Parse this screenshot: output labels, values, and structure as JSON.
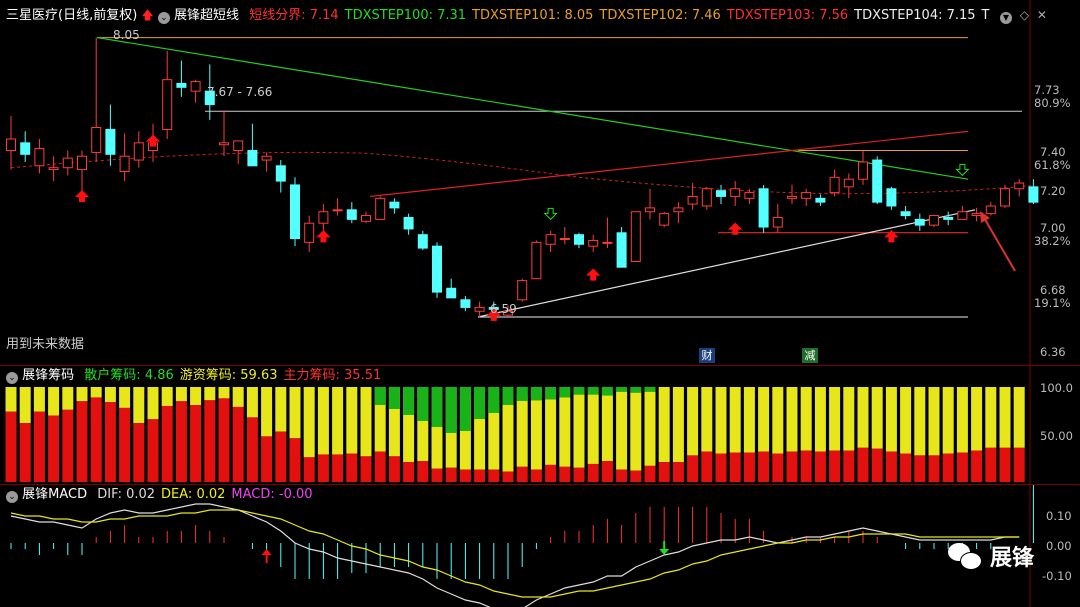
{
  "main_header": {
    "stock": "三星医疗(日线,前复权)",
    "indicator": "展锋超短线",
    "items": [
      {
        "label": "短线分界:",
        "value": "7.14",
        "color": "#ff3030"
      },
      {
        "label": "TDXSTEP100:",
        "value": "7.31",
        "color": "#22dd22"
      },
      {
        "label": "TDXSTEP101:",
        "value": "8.05",
        "color": "#e8a020"
      },
      {
        "label": "TDXSTEP102:",
        "value": "7.46",
        "color": "#e8a020"
      },
      {
        "label": "TDXSTEP103:",
        "value": "7.56",
        "color": "#ff3030"
      },
      {
        "label": "TDXSTEP104:",
        "value": "7.15",
        "color": "#eeeeee"
      },
      {
        "label": "T",
        "value": "",
        "color": "#eeeeee"
      }
    ],
    "icons": [
      "chevron-down-icon",
      "diamond-icon",
      "close-icon"
    ]
  },
  "annotations": {
    "high": "8.05",
    "range": "7.67 - 7.66",
    "low": "6.59",
    "future": "用到未来数据",
    "marker_cai": "财",
    "marker_jian": "减"
  },
  "main_axis": [
    "7.73",
    "80.9%",
    "7.40",
    "61.8%",
    "7.20",
    "7.00",
    "38.2%",
    "6.68",
    "19.1%",
    "6.36"
  ],
  "chips_header": {
    "name": "展锋筹码",
    "items": [
      {
        "label": "散户筹码:",
        "value": "4.86",
        "color": "#22dd22"
      },
      {
        "label": "游资筹码:",
        "value": "59.63",
        "color": "#eeee22"
      },
      {
        "label": "主力筹码:",
        "value": "35.51",
        "color": "#ff3030"
      }
    ]
  },
  "chips_axis": [
    "100.0",
    "50.00"
  ],
  "macd_header": {
    "name": "展锋MACD",
    "items": [
      {
        "label": "DIF:",
        "value": "0.02",
        "color": "#dddddd"
      },
      {
        "label": "DEA:",
        "value": "0.02",
        "color": "#eeee22"
      },
      {
        "label": "MACD:",
        "value": "-0.00",
        "color": "#ee44ee"
      }
    ]
  },
  "macd_axis": [
    "0.10",
    "0.00",
    "-0.10"
  ],
  "watermark": "展锋",
  "chart_data": {
    "type": "candlestick",
    "ylim": [
      6.36,
      8.1
    ],
    "candles": [
      {
        "o": 7.46,
        "h": 7.64,
        "l": 7.36,
        "c": 7.52
      },
      {
        "o": 7.5,
        "h": 7.56,
        "l": 7.4,
        "c": 7.44
      },
      {
        "o": 7.38,
        "h": 7.52,
        "l": 7.34,
        "c": 7.47
      },
      {
        "o": 7.36,
        "h": 7.43,
        "l": 7.3,
        "c": 7.37
      },
      {
        "o": 7.37,
        "h": 7.46,
        "l": 7.33,
        "c": 7.42
      },
      {
        "o": 7.36,
        "h": 7.46,
        "l": 7.22,
        "c": 7.43
      },
      {
        "o": 7.45,
        "h": 8.05,
        "l": 7.4,
        "c": 7.58
      },
      {
        "o": 7.57,
        "h": 7.7,
        "l": 7.38,
        "c": 7.44
      },
      {
        "o": 7.35,
        "h": 7.55,
        "l": 7.3,
        "c": 7.43
      },
      {
        "o": 7.41,
        "h": 7.56,
        "l": 7.37,
        "c": 7.5
      },
      {
        "o": 7.46,
        "h": 7.6,
        "l": 7.4,
        "c": 7.5
      },
      {
        "o": 7.57,
        "h": 7.98,
        "l": 7.52,
        "c": 7.83
      },
      {
        "o": 7.81,
        "h": 7.93,
        "l": 7.74,
        "c": 7.79
      },
      {
        "o": 7.77,
        "h": 7.83,
        "l": 7.71,
        "c": 7.82
      },
      {
        "o": 7.77,
        "h": 7.91,
        "l": 7.62,
        "c": 7.7
      },
      {
        "o": 7.49,
        "h": 7.67,
        "l": 7.43,
        "c": 7.5
      },
      {
        "o": 7.46,
        "h": 7.51,
        "l": 7.39,
        "c": 7.51
      },
      {
        "o": 7.46,
        "h": 7.6,
        "l": 7.38,
        "c": 7.38
      },
      {
        "o": 7.41,
        "h": 7.45,
        "l": 7.35,
        "c": 7.43
      },
      {
        "o": 7.38,
        "h": 7.41,
        "l": 7.24,
        "c": 7.3
      },
      {
        "o": 7.28,
        "h": 7.32,
        "l": 6.96,
        "c": 7.0
      },
      {
        "o": 6.98,
        "h": 7.12,
        "l": 6.93,
        "c": 7.08
      },
      {
        "o": 7.08,
        "h": 7.18,
        "l": 7.04,
        "c": 7.14
      },
      {
        "o": 7.15,
        "h": 7.21,
        "l": 7.12,
        "c": 7.15
      },
      {
        "o": 7.15,
        "h": 7.19,
        "l": 7.08,
        "c": 7.1
      },
      {
        "o": 7.09,
        "h": 7.14,
        "l": 7.08,
        "c": 7.12
      },
      {
        "o": 7.1,
        "h": 7.22,
        "l": 7.1,
        "c": 7.21
      },
      {
        "o": 7.19,
        "h": 7.21,
        "l": 7.13,
        "c": 7.16
      },
      {
        "o": 7.11,
        "h": 7.13,
        "l": 7.02,
        "c": 7.05
      },
      {
        "o": 7.02,
        "h": 7.04,
        "l": 6.94,
        "c": 6.95
      },
      {
        "o": 6.96,
        "h": 6.98,
        "l": 6.69,
        "c": 6.72
      },
      {
        "o": 6.74,
        "h": 6.79,
        "l": 6.7,
        "c": 6.69
      },
      {
        "o": 6.68,
        "h": 6.7,
        "l": 6.62,
        "c": 6.64
      },
      {
        "o": 6.62,
        "h": 6.67,
        "l": 6.59,
        "c": 6.64
      },
      {
        "o": 6.64,
        "h": 6.67,
        "l": 6.63,
        "c": 6.63
      },
      {
        "o": 6.6,
        "h": 6.65,
        "l": 6.59,
        "c": 6.62
      },
      {
        "o": 6.68,
        "h": 6.79,
        "l": 6.67,
        "c": 6.78
      },
      {
        "o": 6.79,
        "h": 6.99,
        "l": 6.79,
        "c": 6.98
      },
      {
        "o": 6.97,
        "h": 7.04,
        "l": 6.93,
        "c": 7.02
      },
      {
        "o": 7.0,
        "h": 7.06,
        "l": 6.97,
        "c": 7.0
      },
      {
        "o": 7.02,
        "h": 7.03,
        "l": 6.95,
        "c": 6.97
      },
      {
        "o": 6.96,
        "h": 7.02,
        "l": 6.93,
        "c": 6.99
      },
      {
        "o": 6.98,
        "h": 7.11,
        "l": 6.95,
        "c": 6.98
      },
      {
        "o": 7.03,
        "h": 7.06,
        "l": 6.85,
        "c": 6.85
      },
      {
        "o": 6.88,
        "h": 7.14,
        "l": 6.88,
        "c": 7.14
      },
      {
        "o": 7.14,
        "h": 7.26,
        "l": 7.1,
        "c": 7.16
      },
      {
        "o": 7.07,
        "h": 7.14,
        "l": 7.06,
        "c": 7.13
      },
      {
        "o": 7.14,
        "h": 7.19,
        "l": 7.08,
        "c": 7.16
      },
      {
        "o": 7.18,
        "h": 7.29,
        "l": 7.15,
        "c": 7.22
      },
      {
        "o": 7.17,
        "h": 7.27,
        "l": 7.15,
        "c": 7.26
      },
      {
        "o": 7.25,
        "h": 7.28,
        "l": 7.18,
        "c": 7.22
      },
      {
        "o": 7.22,
        "h": 7.3,
        "l": 7.17,
        "c": 7.26
      },
      {
        "o": 7.21,
        "h": 7.26,
        "l": 7.18,
        "c": 7.24
      },
      {
        "o": 7.26,
        "h": 7.28,
        "l": 7.03,
        "c": 7.06
      },
      {
        "o": 7.06,
        "h": 7.18,
        "l": 7.03,
        "c": 7.11
      },
      {
        "o": 7.21,
        "h": 7.28,
        "l": 7.18,
        "c": 7.22
      },
      {
        "o": 7.21,
        "h": 7.26,
        "l": 7.17,
        "c": 7.24
      },
      {
        "o": 7.21,
        "h": 7.23,
        "l": 7.17,
        "c": 7.19
      },
      {
        "o": 7.24,
        "h": 7.36,
        "l": 7.22,
        "c": 7.32
      },
      {
        "o": 7.27,
        "h": 7.34,
        "l": 7.21,
        "c": 7.31
      },
      {
        "o": 7.31,
        "h": 7.46,
        "l": 7.28,
        "c": 7.4
      },
      {
        "o": 7.41,
        "h": 7.43,
        "l": 7.18,
        "c": 7.19
      },
      {
        "o": 7.26,
        "h": 7.27,
        "l": 7.15,
        "c": 7.17
      },
      {
        "o": 7.14,
        "h": 7.17,
        "l": 7.1,
        "c": 7.12
      },
      {
        "o": 7.1,
        "h": 7.13,
        "l": 7.04,
        "c": 7.07
      },
      {
        "o": 7.07,
        "h": 7.12,
        "l": 7.06,
        "c": 7.12
      },
      {
        "o": 7.11,
        "h": 7.14,
        "l": 7.07,
        "c": 7.1
      },
      {
        "o": 7.1,
        "h": 7.17,
        "l": 7.1,
        "c": 7.14
      },
      {
        "o": 7.12,
        "h": 7.16,
        "l": 7.09,
        "c": 7.13
      },
      {
        "o": 7.13,
        "h": 7.19,
        "l": 7.12,
        "c": 7.17
      },
      {
        "o": 7.17,
        "h": 7.28,
        "l": 7.16,
        "c": 7.26
      },
      {
        "o": 7.26,
        "h": 7.31,
        "l": 7.22,
        "c": 7.29
      },
      {
        "o": 7.27,
        "h": 7.31,
        "l": 7.18,
        "c": 7.19
      }
    ],
    "chips": {
      "red": [
        74,
        62,
        74,
        70,
        76,
        85,
        89,
        84,
        78,
        62,
        66,
        80,
        85,
        81,
        86,
        88,
        79,
        68,
        48,
        53,
        46,
        26,
        29,
        29,
        30,
        27,
        32,
        27,
        21,
        22,
        14,
        15,
        13,
        13,
        13,
        11,
        16,
        13,
        18,
        16,
        15,
        19,
        22,
        13,
        12,
        17,
        21,
        21,
        28,
        32,
        30,
        31,
        31,
        32,
        30,
        32,
        33,
        32,
        33,
        33,
        36,
        35,
        32,
        30,
        28,
        28,
        30,
        31,
        33,
        36,
        36,
        36
      ],
      "yellow": [
        26,
        38,
        26,
        30,
        24,
        15,
        11,
        16,
        22,
        38,
        34,
        20,
        15,
        19,
        14,
        12,
        21,
        32,
        52,
        47,
        54,
        74,
        71,
        71,
        70,
        73,
        68,
        73,
        79,
        78,
        86,
        85,
        76,
        64,
        74,
        71,
        74,
        73,
        69,
        73,
        77,
        73,
        69,
        82,
        82,
        78,
        79,
        79,
        72,
        68,
        70,
        69,
        69,
        68,
        70,
        68,
        67,
        68,
        67,
        67,
        64,
        65,
        68,
        70,
        72,
        72,
        70,
        69,
        67,
        64,
        64,
        64
      ]
    },
    "macd": {
      "dif": [
        0.09,
        0.08,
        0.07,
        0.07,
        0.06,
        0.05,
        0.08,
        0.1,
        0.11,
        0.1,
        0.1,
        0.11,
        0.12,
        0.13,
        0.13,
        0.12,
        0.11,
        0.09,
        0.07,
        0.04,
        0.0,
        -0.02,
        -0.03,
        -0.05,
        -0.06,
        -0.07,
        -0.08,
        -0.09,
        -0.1,
        -0.12,
        -0.15,
        -0.17,
        -0.19,
        -0.2,
        -0.22,
        -0.23,
        -0.22,
        -0.19,
        -0.17,
        -0.15,
        -0.14,
        -0.13,
        -0.11,
        -0.11,
        -0.08,
        -0.06,
        -0.04,
        -0.03,
        -0.01,
        0.0,
        0.01,
        0.01,
        0.02,
        0.01,
        0.0,
        0.01,
        0.02,
        0.02,
        0.03,
        0.04,
        0.05,
        0.04,
        0.03,
        0.02,
        0.01,
        0.01,
        0.01,
        0.01,
        0.01,
        0.01,
        0.02,
        0.02
      ],
      "dea": [
        0.1,
        0.09,
        0.09,
        0.08,
        0.08,
        0.07,
        0.07,
        0.08,
        0.08,
        0.09,
        0.09,
        0.09,
        0.1,
        0.1,
        0.11,
        0.11,
        0.11,
        0.1,
        0.09,
        0.08,
        0.06,
        0.04,
        0.03,
        0.01,
        -0.01,
        -0.02,
        -0.04,
        -0.05,
        -0.06,
        -0.08,
        -0.09,
        -0.11,
        -0.13,
        -0.14,
        -0.16,
        -0.17,
        -0.18,
        -0.18,
        -0.18,
        -0.17,
        -0.16,
        -0.16,
        -0.15,
        -0.14,
        -0.13,
        -0.12,
        -0.1,
        -0.09,
        -0.07,
        -0.06,
        -0.04,
        -0.03,
        -0.02,
        -0.01,
        0.0,
        0.0,
        0.01,
        0.01,
        0.02,
        0.02,
        0.03,
        0.03,
        0.03,
        0.03,
        0.02,
        0.02,
        0.02,
        0.02,
        0.02,
        0.02,
        0.02,
        0.02
      ]
    }
  }
}
